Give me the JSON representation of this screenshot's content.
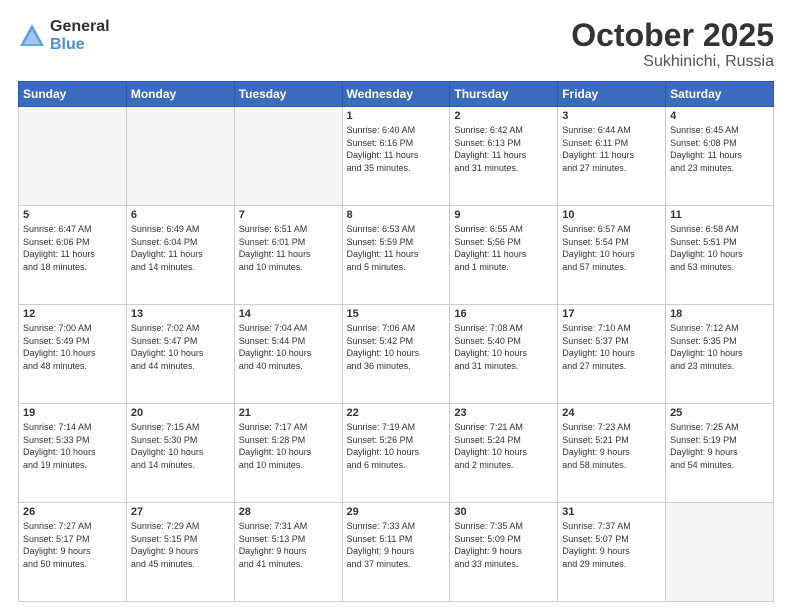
{
  "header": {
    "logo_general": "General",
    "logo_blue": "Blue",
    "title": "October 2025",
    "location": "Sukhinichi, Russia"
  },
  "weekdays": [
    "Sunday",
    "Monday",
    "Tuesday",
    "Wednesday",
    "Thursday",
    "Friday",
    "Saturday"
  ],
  "weeks": [
    [
      {
        "day": "",
        "info": ""
      },
      {
        "day": "",
        "info": ""
      },
      {
        "day": "",
        "info": ""
      },
      {
        "day": "1",
        "info": "Sunrise: 6:40 AM\nSunset: 6:16 PM\nDaylight: 11 hours\nand 35 minutes."
      },
      {
        "day": "2",
        "info": "Sunrise: 6:42 AM\nSunset: 6:13 PM\nDaylight: 11 hours\nand 31 minutes."
      },
      {
        "day": "3",
        "info": "Sunrise: 6:44 AM\nSunset: 6:11 PM\nDaylight: 11 hours\nand 27 minutes."
      },
      {
        "day": "4",
        "info": "Sunrise: 6:45 AM\nSunset: 6:08 PM\nDaylight: 11 hours\nand 23 minutes."
      }
    ],
    [
      {
        "day": "5",
        "info": "Sunrise: 6:47 AM\nSunset: 6:06 PM\nDaylight: 11 hours\nand 18 minutes."
      },
      {
        "day": "6",
        "info": "Sunrise: 6:49 AM\nSunset: 6:04 PM\nDaylight: 11 hours\nand 14 minutes."
      },
      {
        "day": "7",
        "info": "Sunrise: 6:51 AM\nSunset: 6:01 PM\nDaylight: 11 hours\nand 10 minutes."
      },
      {
        "day": "8",
        "info": "Sunrise: 6:53 AM\nSunset: 5:59 PM\nDaylight: 11 hours\nand 5 minutes."
      },
      {
        "day": "9",
        "info": "Sunrise: 6:55 AM\nSunset: 5:56 PM\nDaylight: 11 hours\nand 1 minute."
      },
      {
        "day": "10",
        "info": "Sunrise: 6:57 AM\nSunset: 5:54 PM\nDaylight: 10 hours\nand 57 minutes."
      },
      {
        "day": "11",
        "info": "Sunrise: 6:58 AM\nSunset: 5:51 PM\nDaylight: 10 hours\nand 53 minutes."
      }
    ],
    [
      {
        "day": "12",
        "info": "Sunrise: 7:00 AM\nSunset: 5:49 PM\nDaylight: 10 hours\nand 48 minutes."
      },
      {
        "day": "13",
        "info": "Sunrise: 7:02 AM\nSunset: 5:47 PM\nDaylight: 10 hours\nand 44 minutes."
      },
      {
        "day": "14",
        "info": "Sunrise: 7:04 AM\nSunset: 5:44 PM\nDaylight: 10 hours\nand 40 minutes."
      },
      {
        "day": "15",
        "info": "Sunrise: 7:06 AM\nSunset: 5:42 PM\nDaylight: 10 hours\nand 36 minutes."
      },
      {
        "day": "16",
        "info": "Sunrise: 7:08 AM\nSunset: 5:40 PM\nDaylight: 10 hours\nand 31 minutes."
      },
      {
        "day": "17",
        "info": "Sunrise: 7:10 AM\nSunset: 5:37 PM\nDaylight: 10 hours\nand 27 minutes."
      },
      {
        "day": "18",
        "info": "Sunrise: 7:12 AM\nSunset: 5:35 PM\nDaylight: 10 hours\nand 23 minutes."
      }
    ],
    [
      {
        "day": "19",
        "info": "Sunrise: 7:14 AM\nSunset: 5:33 PM\nDaylight: 10 hours\nand 19 minutes."
      },
      {
        "day": "20",
        "info": "Sunrise: 7:15 AM\nSunset: 5:30 PM\nDaylight: 10 hours\nand 14 minutes."
      },
      {
        "day": "21",
        "info": "Sunrise: 7:17 AM\nSunset: 5:28 PM\nDaylight: 10 hours\nand 10 minutes."
      },
      {
        "day": "22",
        "info": "Sunrise: 7:19 AM\nSunset: 5:26 PM\nDaylight: 10 hours\nand 6 minutes."
      },
      {
        "day": "23",
        "info": "Sunrise: 7:21 AM\nSunset: 5:24 PM\nDaylight: 10 hours\nand 2 minutes."
      },
      {
        "day": "24",
        "info": "Sunrise: 7:23 AM\nSunset: 5:21 PM\nDaylight: 9 hours\nand 58 minutes."
      },
      {
        "day": "25",
        "info": "Sunrise: 7:25 AM\nSunset: 5:19 PM\nDaylight: 9 hours\nand 54 minutes."
      }
    ],
    [
      {
        "day": "26",
        "info": "Sunrise: 7:27 AM\nSunset: 5:17 PM\nDaylight: 9 hours\nand 50 minutes."
      },
      {
        "day": "27",
        "info": "Sunrise: 7:29 AM\nSunset: 5:15 PM\nDaylight: 9 hours\nand 45 minutes."
      },
      {
        "day": "28",
        "info": "Sunrise: 7:31 AM\nSunset: 5:13 PM\nDaylight: 9 hours\nand 41 minutes."
      },
      {
        "day": "29",
        "info": "Sunrise: 7:33 AM\nSunset: 5:11 PM\nDaylight: 9 hours\nand 37 minutes."
      },
      {
        "day": "30",
        "info": "Sunrise: 7:35 AM\nSunset: 5:09 PM\nDaylight: 9 hours\nand 33 minutes."
      },
      {
        "day": "31",
        "info": "Sunrise: 7:37 AM\nSunset: 5:07 PM\nDaylight: 9 hours\nand 29 minutes."
      },
      {
        "day": "",
        "info": ""
      }
    ]
  ]
}
